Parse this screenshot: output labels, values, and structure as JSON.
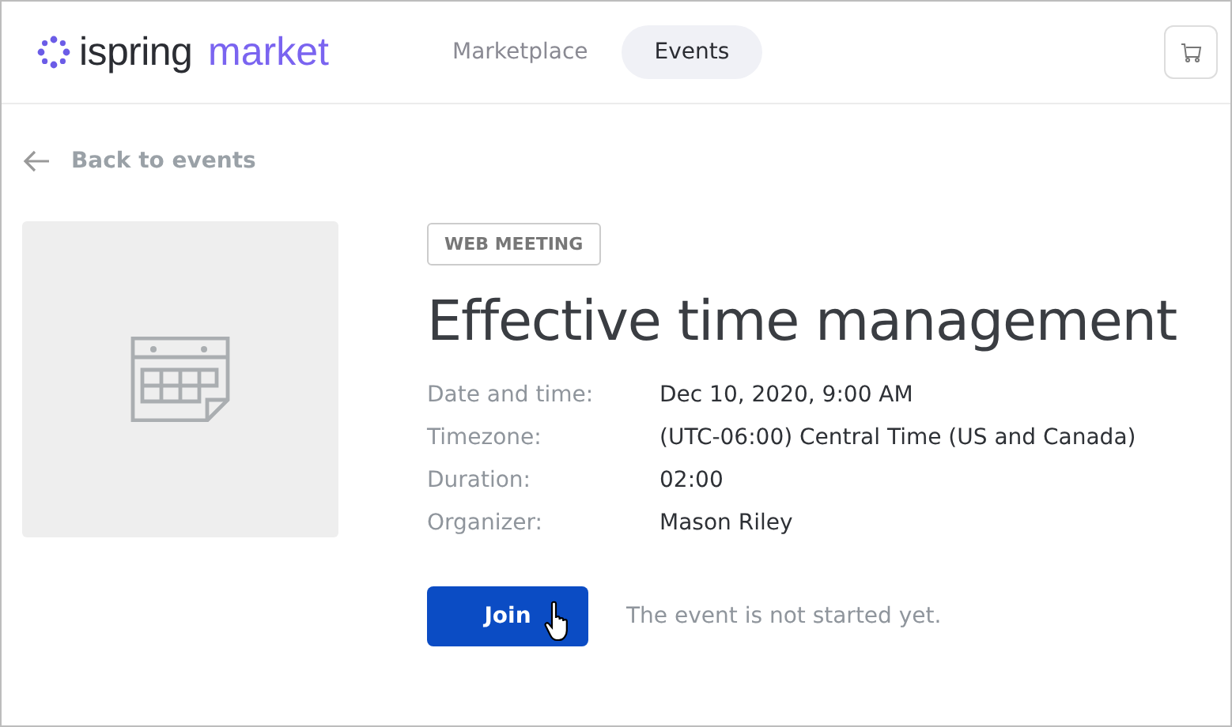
{
  "header": {
    "logo": {
      "brand": "ispring",
      "product": "market"
    },
    "tabs": [
      {
        "label": "Marketplace",
        "selected": false
      },
      {
        "label": "Events",
        "selected": true
      }
    ]
  },
  "back_link": "Back to events",
  "event": {
    "badge": "WEB MEETING",
    "title": "Effective time management",
    "details": [
      {
        "label": "Date and time:",
        "value": "Dec 10, 2020, 9:00 AM"
      },
      {
        "label": "Timezone:",
        "value": "(UTC-06:00) Central Time (US and Canada)"
      },
      {
        "label": "Duration:",
        "value": "02:00"
      },
      {
        "label": "Organizer:",
        "value": "Mason Riley"
      }
    ],
    "join_button": "Join",
    "status": "The event is not started yet."
  }
}
